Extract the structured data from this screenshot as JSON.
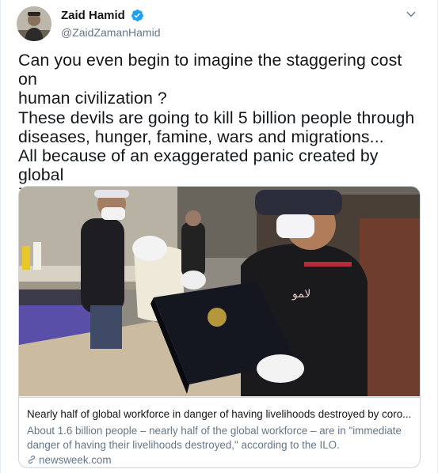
{
  "author": {
    "display_name": "Zaid Hamid",
    "handle": "@ZaidZamanHamid",
    "verified_icon": "verified-badge-icon",
    "avatar_icon": "avatar"
  },
  "tweet": {
    "text": "Can you even begin to imagine the staggering cost on\nhuman civilization ?\nThese devils are going to kill 5 billion people through\ndiseases, hunger, famine, wars and migrations...\nAll because of an exaggerated panic created by global\nZionists..."
  },
  "card": {
    "title": "Nearly half of global workforce in danger of having livelihoods destroyed by coro...",
    "description": "About 1.6 billion people – nearly half of the global workforce – are in \"immediate danger of having their livelihoods destroyed,\" according to the ILO.",
    "domain": "newsweek.com",
    "image_icon": "article-photo"
  },
  "colors": {
    "primary_text": "#14171a",
    "secondary_text": "#657786",
    "border": "#ccd6dd",
    "verified_blue": "#1da1f2"
  }
}
